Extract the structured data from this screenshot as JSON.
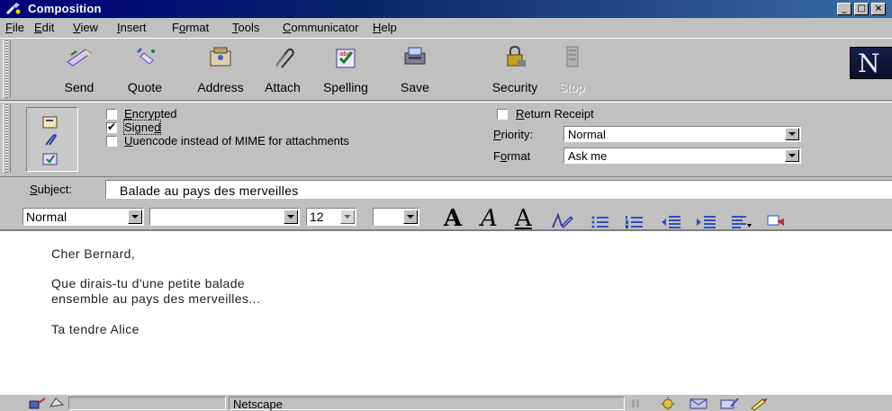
{
  "window": {
    "title": "Composition",
    "controls": [
      "_",
      "□",
      "×"
    ]
  },
  "menu": {
    "items": [
      {
        "pre": "",
        "u": "F",
        "post": "ile"
      },
      {
        "pre": "",
        "u": "E",
        "post": "dit"
      },
      {
        "pre": "",
        "u": "V",
        "post": "iew"
      },
      {
        "pre": "",
        "u": "I",
        "post": "nsert"
      },
      {
        "pre": "F",
        "u": "o",
        "post": "rmat"
      },
      {
        "pre": "",
        "u": "T",
        "post": "ools"
      },
      {
        "pre": "",
        "u": "C",
        "post": "ommunicator"
      },
      {
        "pre": "",
        "u": "H",
        "post": "elp"
      }
    ]
  },
  "toolbar": {
    "buttons": [
      {
        "label": "Send",
        "icon": "send-icon",
        "enabled": true
      },
      {
        "label": "Quote",
        "icon": "quote-icon",
        "enabled": true
      },
      {
        "label": "Address",
        "icon": "address-book-icon",
        "enabled": true
      },
      {
        "label": "Attach",
        "icon": "paperclip-icon",
        "enabled": true
      },
      {
        "label": "Spelling",
        "icon": "spelling-icon",
        "enabled": true
      },
      {
        "label": "Save",
        "icon": "save-icon",
        "enabled": true
      },
      {
        "label": "Security",
        "icon": "lock-icon",
        "enabled": true
      },
      {
        "label": "Stop",
        "icon": "stop-icon",
        "enabled": false
      }
    ],
    "logo_letter": "N"
  },
  "options": {
    "encrypted": {
      "u": "E",
      "rest": "ncrypted",
      "checked": false
    },
    "signed": {
      "pre": "Signe",
      "u": "d",
      "post": "",
      "checked": true
    },
    "uuencode": {
      "u": "U",
      "rest": "uencode instead of MIME for attachments",
      "checked": false
    },
    "return_receipt": {
      "u": "R",
      "rest": "eturn Receipt",
      "checked": false
    },
    "priority": {
      "label_u": "P",
      "label_rest": "riority:",
      "value": "Normal"
    },
    "format": {
      "label_pre": "F",
      "label_u": "o",
      "label_rest": "rmat",
      "value": "Ask me"
    }
  },
  "subject": {
    "label_u": "S",
    "label_rest": "ubject:",
    "value": "Balade au pays des merveilles"
  },
  "format_bar": {
    "paragraph_style": "Normal",
    "font": "",
    "font_size": "12",
    "color": "",
    "glyph_A": "A"
  },
  "body": {
    "lines": [
      "Cher Bernard,",
      "Que dirais-tu d'une petite balade",
      "ensemble au pays des merveilles...",
      "Ta tendre Alice"
    ]
  },
  "status": {
    "text": "Netscape"
  },
  "colors": {
    "title_start": "#00007c",
    "title_end": "#3a6ea5",
    "face": "#c0c0c0"
  }
}
